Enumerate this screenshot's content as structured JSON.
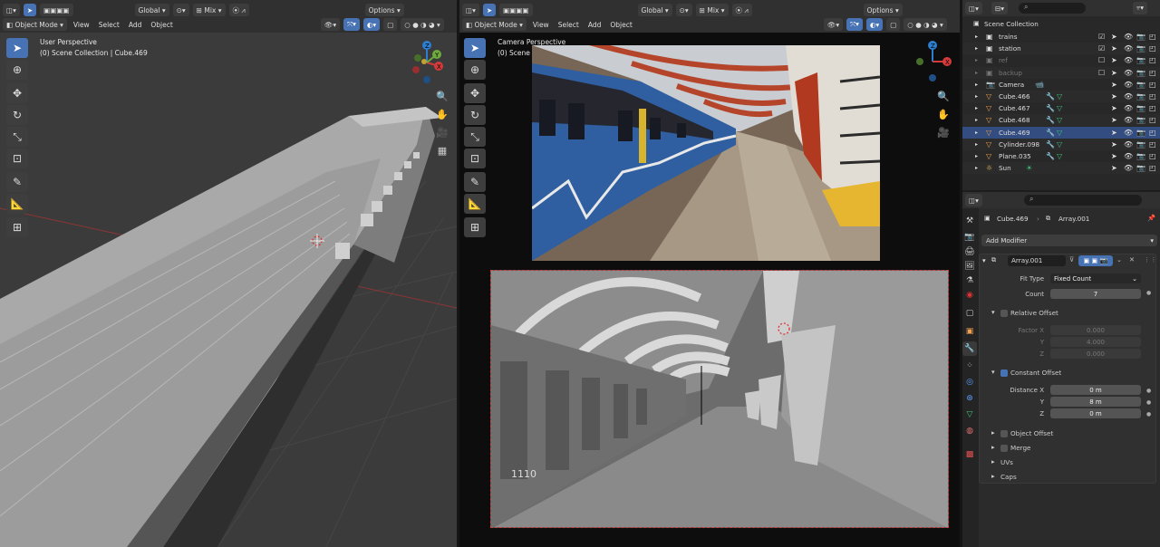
{
  "left_viewport": {
    "mode": "Object Mode",
    "menus": [
      "View",
      "Select",
      "Add",
      "Object"
    ],
    "transform": "Global",
    "snap": "Mix",
    "options": "Options",
    "perspective": "User Perspective",
    "collection_info": "(0) Scene Collection | Cube.469"
  },
  "camera_viewport": {
    "mode": "Object Mode",
    "menus": [
      "View",
      "Select",
      "Add",
      "Object"
    ],
    "transform": "Global",
    "snap": "Mix",
    "options": "Options",
    "perspective": "Camera Perspective",
    "collection_info": "(0) Scene C"
  },
  "render_overlay_text": "1110",
  "outliner": {
    "root": "Scene Collection",
    "items": [
      {
        "name": "trains",
        "icon": "collection-icon",
        "disabled": false
      },
      {
        "name": "station",
        "icon": "collection-icon",
        "disabled": false
      },
      {
        "name": "ref",
        "icon": "collection-icon",
        "disabled": true
      },
      {
        "name": "backup",
        "icon": "collection-icon",
        "disabled": true
      },
      {
        "name": "Camera",
        "icon": "camera-object-icon",
        "disabled": false
      },
      {
        "name": "Cube.466",
        "icon": "mesh-object-icon",
        "disabled": false
      },
      {
        "name": "Cube.467",
        "icon": "mesh-object-icon",
        "disabled": false
      },
      {
        "name": "Cube.468",
        "icon": "mesh-object-icon",
        "disabled": false
      },
      {
        "name": "Cube.469",
        "icon": "mesh-object-icon",
        "disabled": false
      },
      {
        "name": "Cylinder.098",
        "icon": "mesh-object-icon",
        "disabled": false
      },
      {
        "name": "Plane.035",
        "icon": "mesh-object-icon",
        "disabled": false
      },
      {
        "name": "Sun",
        "icon": "light-object-icon",
        "disabled": false
      }
    ],
    "colors": {
      "selected_row": "#334d80",
      "mesh": "#f0a050",
      "green": "#3fc47d"
    }
  },
  "properties": {
    "object_name": "Cube.469",
    "modifier_breadcrumb": "Array.001",
    "add_modifier": "Add Modifier",
    "modifier_name": "Array.001",
    "fit_type_label": "Fit Type",
    "fit_type_value": "Fixed Count",
    "count_label": "Count",
    "count_value": "7",
    "relative_offset_label": "Relative Offset",
    "factor_x_label": "Factor X",
    "factor_x": "0.000",
    "factor_y_label": "Y",
    "factor_y": "4.000",
    "factor_z_label": "Z",
    "factor_z": "0.000",
    "constant_offset_label": "Constant Offset",
    "distance_x_label": "Distance X",
    "distance_x": "0 m",
    "distance_y_label": "Y",
    "distance_y": "8 m",
    "distance_z_label": "Z",
    "distance_z": "0 m",
    "object_offset_label": "Object Offset",
    "merge_label": "Merge",
    "uvs_label": "UVs",
    "caps_label": "Caps"
  }
}
